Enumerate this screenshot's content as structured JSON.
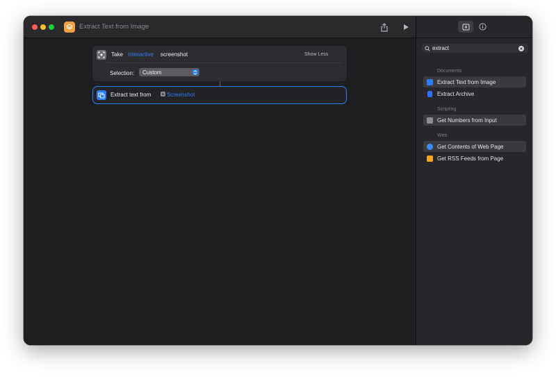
{
  "window": {
    "title": "Extract Text from Image"
  },
  "colors": {
    "accent": "#2f7df6",
    "app_icon": "#f0a040"
  },
  "workflow": {
    "actions": [
      {
        "verb": "Take",
        "param": "Interactive",
        "noun": "screenshot",
        "toggle": "Show Less",
        "selection_label": "Selection:",
        "selection_value": "Custom"
      },
      {
        "label": "Extract text from",
        "variable": "Screenshot"
      }
    ]
  },
  "sidebar": {
    "search": {
      "value": "extract"
    },
    "sections": [
      {
        "header": "Documents",
        "items": [
          {
            "label": "Extract Text from Image",
            "icon": "text-recognition-icon",
            "selected": true
          },
          {
            "label": "Extract Archive",
            "icon": "archive-icon",
            "selected": false
          }
        ]
      },
      {
        "header": "Scripting",
        "items": [
          {
            "label": "Get Numbers from Input",
            "icon": "numbers-icon",
            "selected": true
          }
        ]
      },
      {
        "header": "Web",
        "items": [
          {
            "label": "Get Contents of Web Page",
            "icon": "safari-icon",
            "selected": true
          },
          {
            "label": "Get RSS Feeds from Page",
            "icon": "rss-icon",
            "selected": false
          }
        ]
      }
    ]
  }
}
